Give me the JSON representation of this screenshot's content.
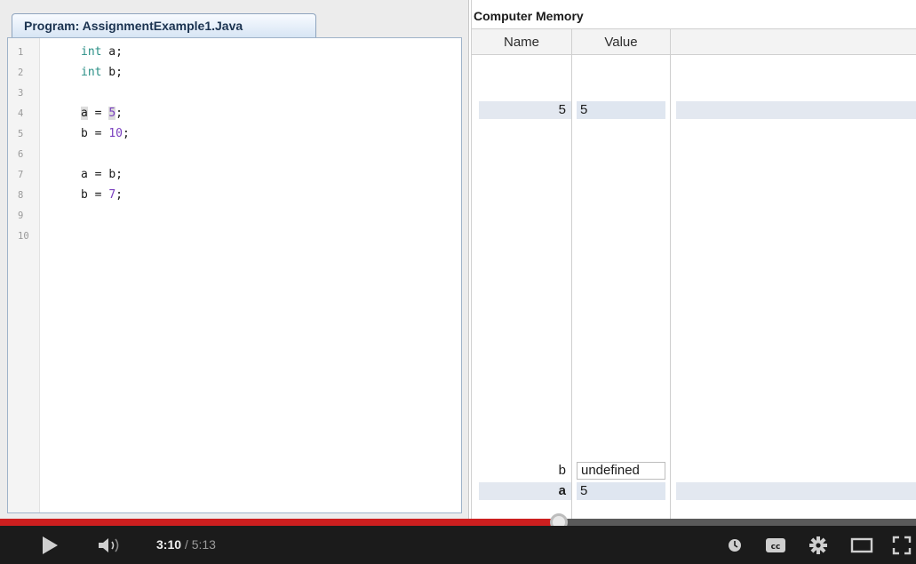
{
  "editor": {
    "tab_label": "Program: AssignmentExample1.Java",
    "lines": [
      {
        "num": "1",
        "kw": "int",
        "rest": " a;"
      },
      {
        "num": "2",
        "kw": "int",
        "rest": " b;"
      },
      {
        "num": "3"
      },
      {
        "num": "4",
        "var": "a",
        "op": " = ",
        "val": "5",
        "end": ";"
      },
      {
        "num": "5",
        "var": "b",
        "op": " = ",
        "val": "10",
        "end": ";"
      },
      {
        "num": "6"
      },
      {
        "num": "7",
        "var": "a",
        "op": " = ",
        "val2": "b",
        "end": ";"
      },
      {
        "num": "8",
        "var": "b",
        "op": " = ",
        "val": "7",
        "end": ";"
      },
      {
        "num": "9"
      },
      {
        "num": "10"
      }
    ]
  },
  "memory": {
    "title": "Computer Memory",
    "columns": {
      "name": "Name",
      "value": "Value"
    },
    "rows": [
      {
        "name": "5",
        "value": "5"
      },
      {
        "name": "b",
        "value": "undefined"
      },
      {
        "name": "a",
        "value": "5"
      }
    ]
  },
  "player": {
    "time_current": "3:10",
    "time_total": "/ 5:13",
    "progress_fraction": 0.61,
    "icons": [
      "play-icon",
      "volume-icon",
      "watch-later-icon",
      "captions-icon",
      "settings-icon",
      "theater-mode-icon",
      "fullscreen-icon"
    ]
  }
}
